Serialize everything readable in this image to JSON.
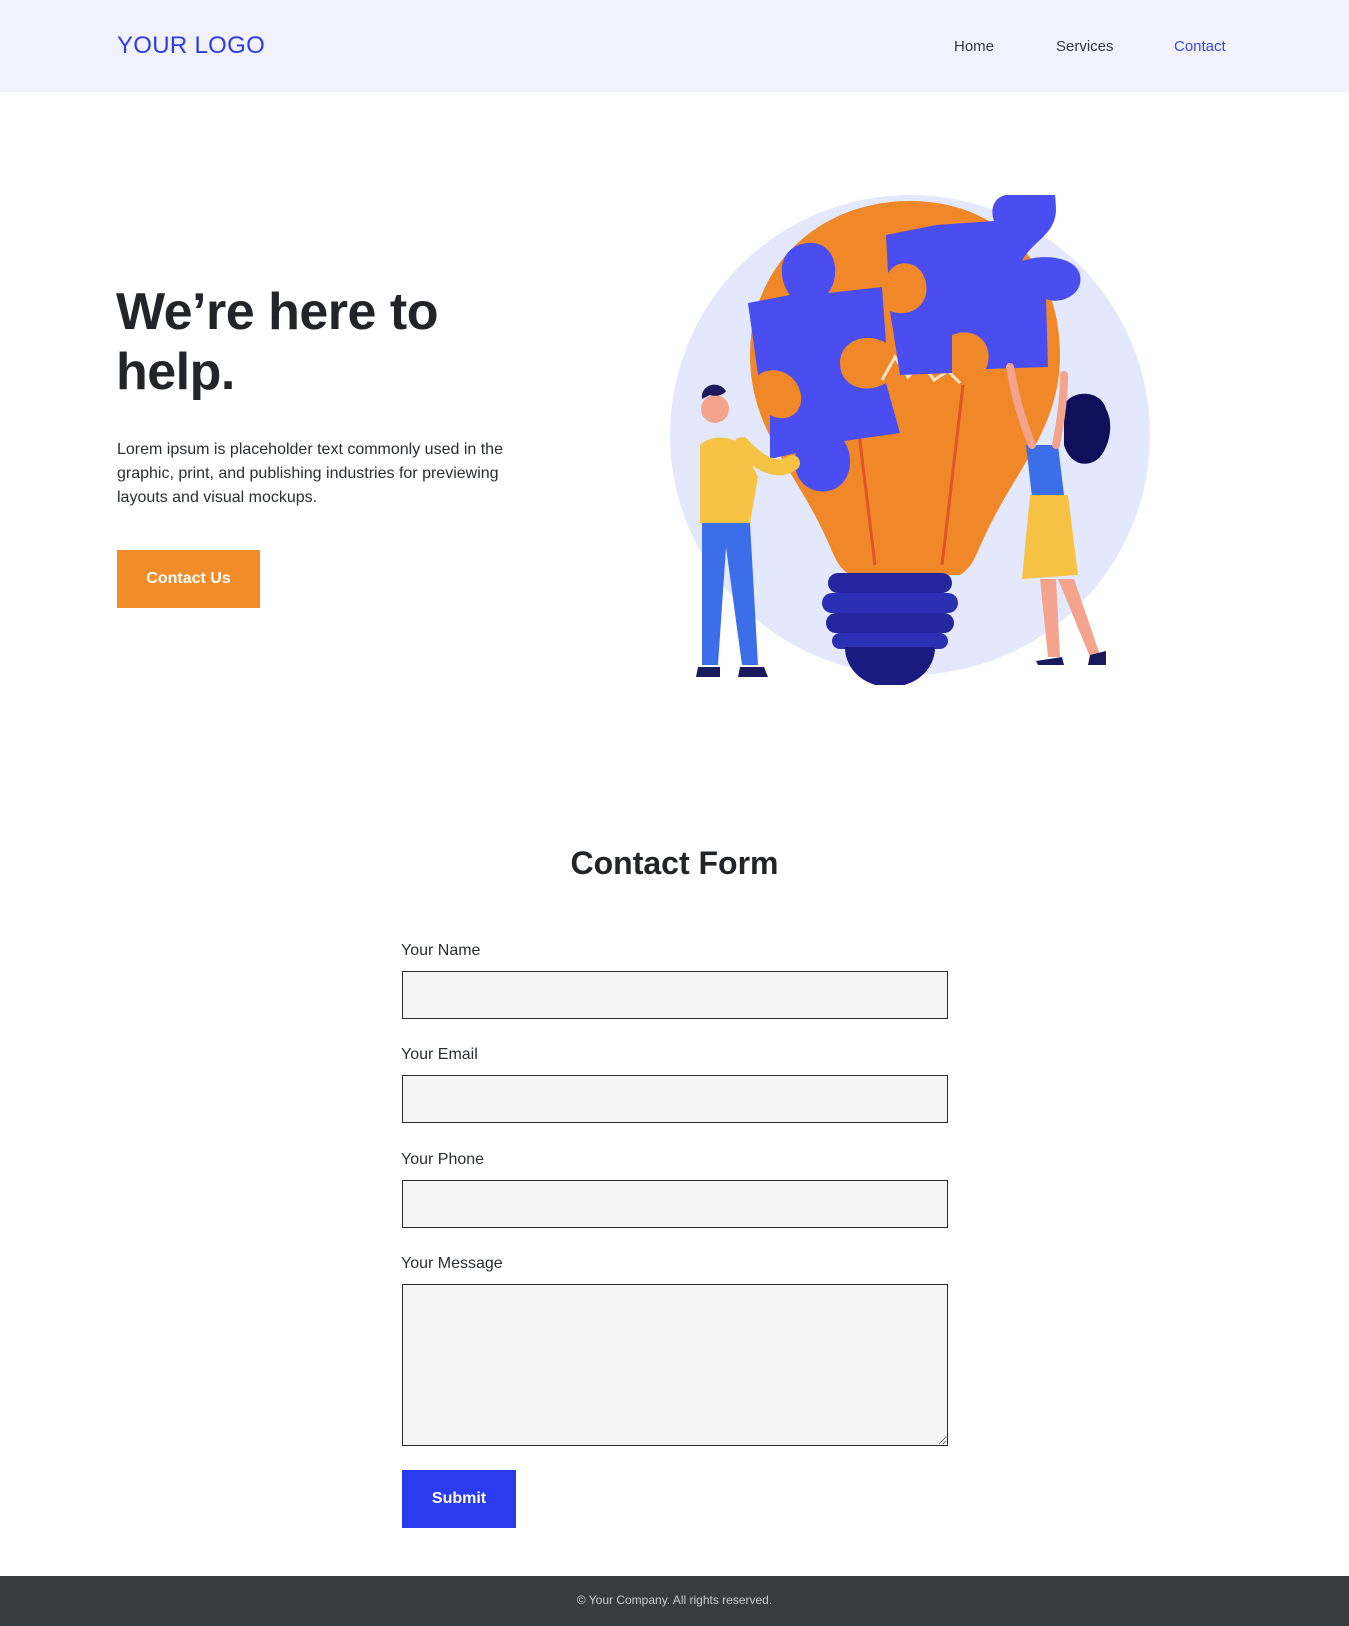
{
  "header": {
    "logo": "YOUR LOGO",
    "nav": [
      {
        "label": "Home",
        "active": false
      },
      {
        "label": "Services",
        "active": false
      },
      {
        "label": "Contact",
        "active": true
      }
    ]
  },
  "hero": {
    "title": "We’re here to help.",
    "text": "Lorem ipsum is placeholder text commonly used in the graphic, print, and publishing industries for previewing layouts and visual mockups.",
    "button": "Contact Us",
    "illustration_icon": "lightbulb-puzzle-illustration"
  },
  "form": {
    "title": "Contact Form",
    "fields": [
      {
        "label": "Your Name",
        "value": ""
      },
      {
        "label": "Your Email",
        "value": ""
      },
      {
        "label": "Your Phone",
        "value": ""
      },
      {
        "label": "Your Message",
        "value": ""
      }
    ],
    "submit": "Submit"
  },
  "footer": {
    "text": "© Your Company. All rights reserved."
  },
  "colors": {
    "brand": "#2f3cde",
    "accent": "#f28c28",
    "submit": "#2b3cf0",
    "header_bg": "#f1f2fe",
    "footer_bg": "#373d3f"
  }
}
